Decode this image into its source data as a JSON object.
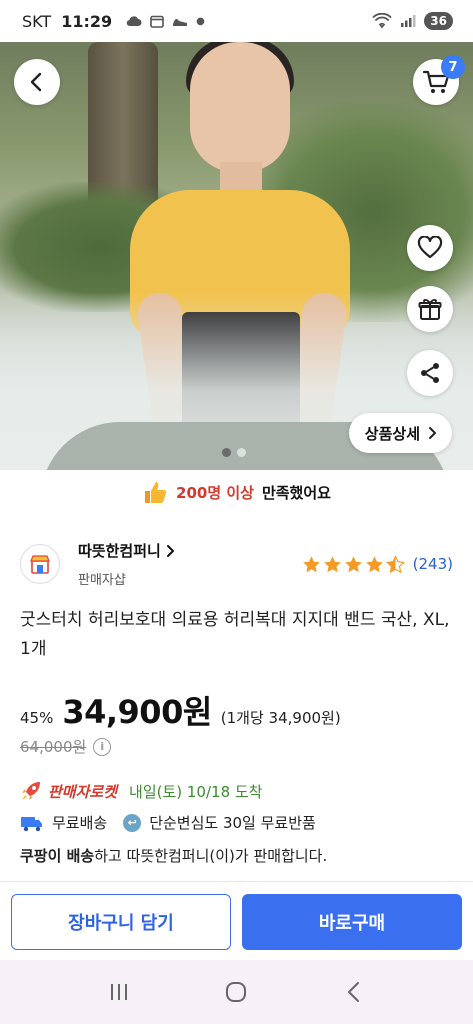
{
  "status_bar": {
    "carrier": "SKT",
    "time": "11:29",
    "battery": "36"
  },
  "hero": {
    "cart_count": "7",
    "detail_label": "상품상세",
    "slide_count": 2,
    "active_slide": 1
  },
  "satisfaction": {
    "highlight": "200명 이상",
    "text": "만족했어요"
  },
  "seller": {
    "name": "따뜻한컴퍼니",
    "subtitle": "판매자샵",
    "rating_count": "(243)",
    "rating_stars": 4.5
  },
  "product": {
    "title": "굿스터치 허리보호대 의료용 허리복대 지지대 밴드 국산, XL, 1개",
    "discount": "45%",
    "price": "34,900원",
    "unit_price": "(1개당 34,900원)",
    "original_price": "64,000원"
  },
  "delivery": {
    "badge": "판매자로켓",
    "date": "내일(토) 10/18 도착",
    "free_shipping": "무료배송",
    "return_policy": "단순변심도 30일 무료반품",
    "note_bold": "쿠팡이 배송",
    "note_rest": "하고 따뜻한컴퍼니(이)가 판매합니다."
  },
  "actions": {
    "cart_button": "장바구니 담기",
    "buy_button": "바로구매"
  },
  "colors": {
    "accent": "#3a6ff0",
    "rocket_red": "#d23a2e",
    "date_green": "#3d8c2e",
    "star": "#f59a23"
  }
}
